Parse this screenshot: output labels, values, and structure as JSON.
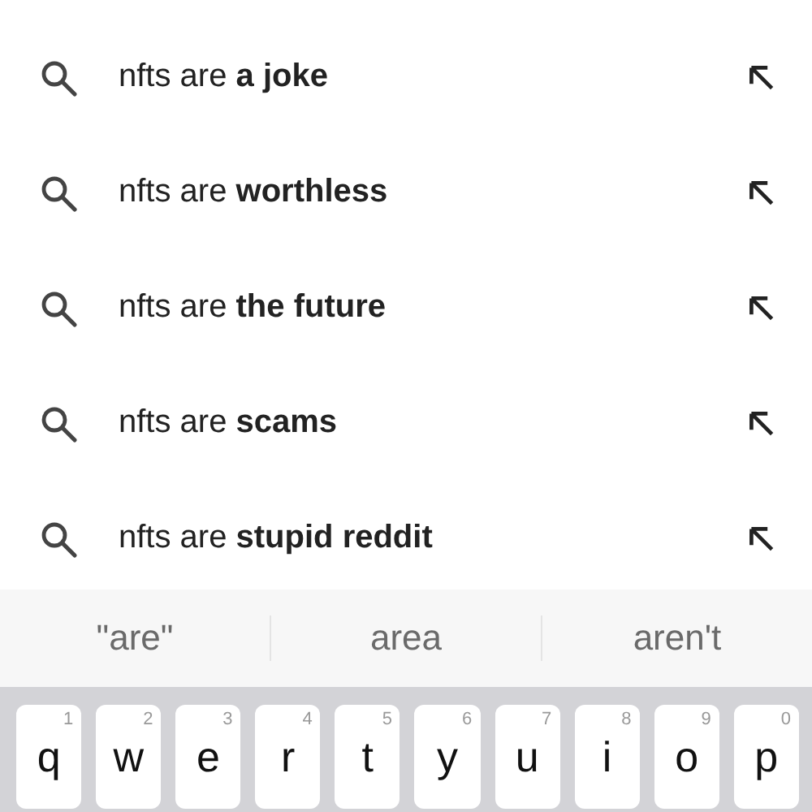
{
  "suggestions": [
    {
      "text": "nfts are **a joke**"
    },
    {
      "text": "nfts are **worthless**"
    },
    {
      "text": "nfts are **the future**"
    },
    {
      "text": "nfts are **scams**"
    },
    {
      "text": "nfts are **stupid reddit**"
    }
  ],
  "predictions": [
    "\"are\"",
    "area",
    "aren't"
  ],
  "keyboard": {
    "keys": [
      {
        "letter": "q",
        "hint": "1"
      },
      {
        "letter": "w",
        "hint": "2"
      },
      {
        "letter": "e",
        "hint": "3"
      },
      {
        "letter": "r",
        "hint": "4"
      },
      {
        "letter": "t",
        "hint": "5"
      },
      {
        "letter": "y",
        "hint": "6"
      },
      {
        "letter": "u",
        "hint": "7"
      },
      {
        "letter": "i",
        "hint": "8"
      },
      {
        "letter": "o",
        "hint": "9"
      },
      {
        "letter": "p",
        "hint": "0"
      }
    ]
  }
}
